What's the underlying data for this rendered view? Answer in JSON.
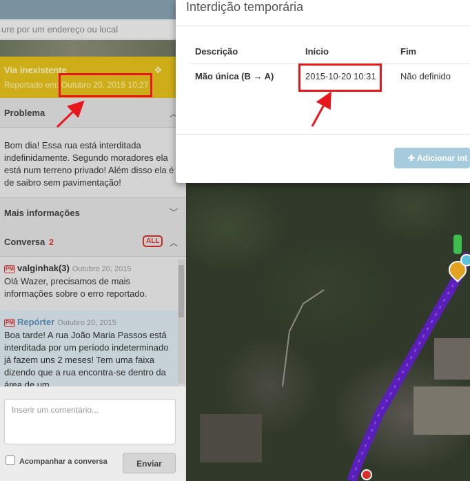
{
  "search": {
    "placeholder": "ure por um endereço ou local"
  },
  "report": {
    "title": "Via inexistente",
    "reported_label": "Reportado em:",
    "reported_date": "Outubro 20, 2015 10:27"
  },
  "problem": {
    "heading": "Problema",
    "text": "Bom dia! Essa rua está interditada indefinidamente. Segundo moradores ela está num terreno privado! Além disso ela é de saibro sem pavimentação!"
  },
  "more_info": {
    "heading": "Mais informações"
  },
  "conversation": {
    "heading": "Conversa",
    "count": "2",
    "all_badge": "ALL",
    "messages": [
      {
        "pm": "PM",
        "author": "valginhak(3)",
        "date": "Outubro 20, 2015",
        "text": "Olá Wazer, precisamos de mais informações sobre o erro reportado."
      },
      {
        "pm": "PM",
        "author": "Repórter",
        "date": "Outubro 20, 2015",
        "text": "Boa tarde! A rua João Maria Passos está interditada por um período indeterminado já fazem uns 2 meses! Tem uma faixa dizendo que a rua encontra-se dentro da área de um"
      }
    ]
  },
  "comment": {
    "placeholder": "Inserir um comentário..."
  },
  "follow": {
    "label": "Acompanhar a conversa"
  },
  "send": {
    "label": "Enviar"
  },
  "dialog": {
    "title": "Interdição temporária",
    "columns": {
      "description": "Descrição",
      "start": "Início",
      "end": "Fim"
    },
    "row": {
      "description": "Mão única (B → A)",
      "start": "2015-10-20 10:31",
      "end": "Não definido"
    },
    "add_button": "✚ Adicionar int"
  },
  "colors": {
    "report_header": "#e6c21b",
    "annotation_red": "#e8161b",
    "road_purple": "#5a1fb8",
    "add_button": "#a6cbdd"
  }
}
